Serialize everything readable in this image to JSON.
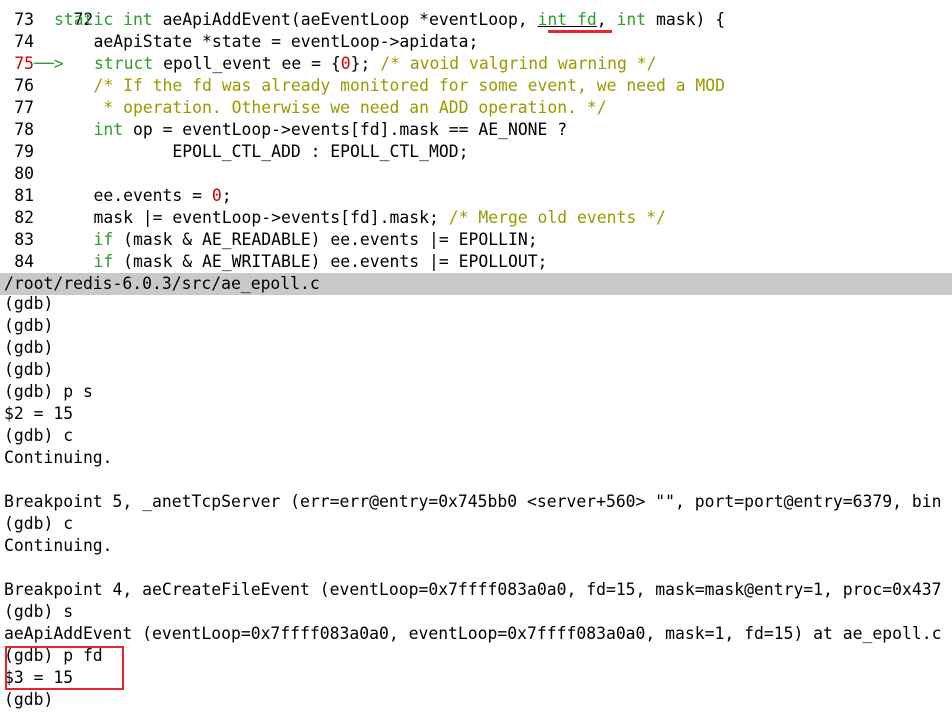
{
  "source": {
    "top_partial_lineno": "72",
    "lines": [
      {
        "no": "73",
        "parts": [
          {
            "t": "static int ",
            "c": "kw"
          },
          {
            "t": "aeApiAddEvent(aeEventLoop *eventLoop, ",
            "c": "code"
          },
          {
            "t": "int fd",
            "c": "kw ul"
          },
          {
            "t": ", ",
            "c": "code"
          },
          {
            "t": "int",
            "c": "kw"
          },
          {
            "t": " mask) {",
            "c": "code"
          }
        ]
      },
      {
        "no": "74",
        "parts": [
          {
            "t": "    aeApiState *state = eventLoop->apidata;",
            "c": "code"
          }
        ]
      },
      {
        "no": "75",
        "current": true,
        "parts": [
          {
            "t": "struct",
            "c": "kw"
          },
          {
            "t": " epoll_event ee = {",
            "c": "code"
          },
          {
            "t": "0",
            "c": "num"
          },
          {
            "t": "}; ",
            "c": "code"
          },
          {
            "t": "/* avoid valgrind warning */",
            "c": "cm"
          }
        ]
      },
      {
        "no": "76",
        "parts": [
          {
            "t": "    /* If the fd was already monitored for some event, we need a MOD",
            "c": "cm"
          }
        ]
      },
      {
        "no": "77",
        "parts": [
          {
            "t": "     * operation. Otherwise we need an ADD operation. */",
            "c": "cm"
          }
        ]
      },
      {
        "no": "78",
        "parts": [
          {
            "t": "    ",
            "c": "code"
          },
          {
            "t": "int",
            "c": "kw"
          },
          {
            "t": " op = eventLoop->events[fd].mask == AE_NONE ?",
            "c": "code"
          }
        ]
      },
      {
        "no": "79",
        "parts": [
          {
            "t": "            EPOLL_CTL_ADD : EPOLL_CTL_MOD;",
            "c": "code"
          }
        ]
      },
      {
        "no": "80",
        "parts": []
      },
      {
        "no": "81",
        "parts": [
          {
            "t": "    ee.events = ",
            "c": "code"
          },
          {
            "t": "0",
            "c": "num"
          },
          {
            "t": ";",
            "c": "code"
          }
        ]
      },
      {
        "no": "82",
        "parts": [
          {
            "t": "    mask |= eventLoop->events[fd].mask; ",
            "c": "code"
          },
          {
            "t": "/* Merge old events */",
            "c": "cm"
          }
        ]
      },
      {
        "no": "83",
        "parts": [
          {
            "t": "    ",
            "c": "code"
          },
          {
            "t": "if",
            "c": "kw"
          },
          {
            "t": " (mask & AE_READABLE) ee.events |= EPOLLIN;",
            "c": "code"
          }
        ]
      },
      {
        "no": "84",
        "parts": [
          {
            "t": "    ",
            "c": "code"
          },
          {
            "t": "if",
            "c": "kw"
          },
          {
            "t": " (mask & AE_WRITABLE) ee.events |= EPOLLOUT;",
            "c": "code"
          }
        ]
      }
    ],
    "current_marker": "──> "
  },
  "status_path": "/root/redis-6.0.3/src/ae_epoll.c",
  "gdb_lines": [
    "(gdb)",
    "(gdb)",
    "(gdb)",
    "(gdb)",
    "(gdb) p s",
    "$2 = 15",
    "(gdb) c",
    "Continuing.",
    "",
    "Breakpoint 5, _anetTcpServer (err=err@entry=0x745bb0 <server+560> \"\", port=port@entry=6379, bin",
    "(gdb) c",
    "Continuing.",
    "",
    "Breakpoint 4, aeCreateFileEvent (eventLoop=0x7ffff083a0a0, fd=15, mask=mask@entry=1, proc=0x437",
    "(gdb) s",
    "aeApiAddEvent (eventLoop=0x7ffff083a0a0, eventLoop=0x7ffff083a0a0, mask=1, fd=15) at ae_epoll.c",
    "(gdb) p fd",
    "$3 = 15",
    "(gdb)"
  ],
  "colors": {
    "keyword": "#2e9c2e",
    "comment": "#9a9a00",
    "number": "#d20000",
    "annotation": "#e4252c",
    "statusbar": "#c9c9c9"
  }
}
